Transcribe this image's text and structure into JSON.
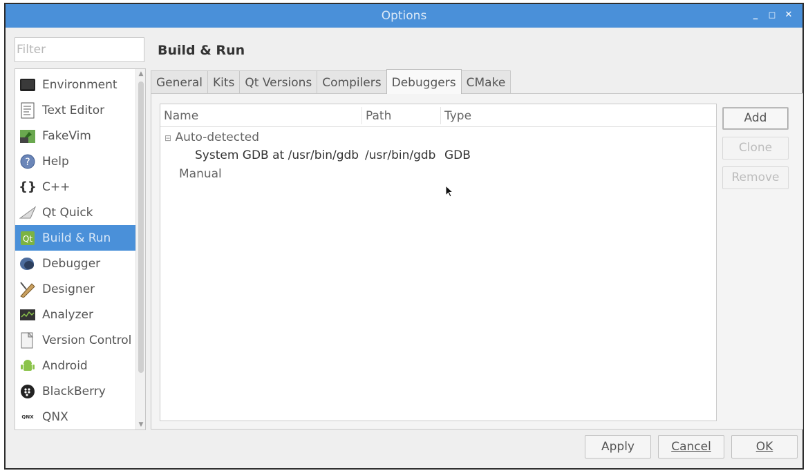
{
  "window": {
    "title": "Options",
    "controls": {
      "minimize": "_",
      "maximize": "□",
      "close": "✕"
    }
  },
  "filter": {
    "placeholder": "Filter",
    "value": ""
  },
  "categories": [
    {
      "label": "Environment",
      "icon": "monitor-icon"
    },
    {
      "label": "Text Editor",
      "icon": "text-document-icon"
    },
    {
      "label": "FakeVim",
      "icon": "fakevim-icon"
    },
    {
      "label": "Help",
      "icon": "help-icon"
    },
    {
      "label": "C++",
      "icon": "braces-icon"
    },
    {
      "label": "Qt Quick",
      "icon": "paper-plane-icon"
    },
    {
      "label": "Build & Run",
      "icon": "build-run-icon",
      "selected": true
    },
    {
      "label": "Debugger",
      "icon": "debugger-icon"
    },
    {
      "label": "Designer",
      "icon": "designer-pen-icon"
    },
    {
      "label": "Analyzer",
      "icon": "analyzer-icon"
    },
    {
      "label": "Version Control",
      "icon": "version-control-icon"
    },
    {
      "label": "Android",
      "icon": "android-icon"
    },
    {
      "label": "BlackBerry",
      "icon": "blackberry-icon"
    },
    {
      "label": "QNX",
      "icon": "qnx-icon"
    }
  ],
  "page": {
    "title": "Build & Run"
  },
  "tabs": [
    {
      "label": "General"
    },
    {
      "label": "Kits"
    },
    {
      "label": "Qt Versions"
    },
    {
      "label": "Compilers"
    },
    {
      "label": "Debuggers",
      "active": true
    },
    {
      "label": "CMake"
    }
  ],
  "tree": {
    "columns": [
      "Name",
      "Path",
      "Type"
    ],
    "groups": [
      {
        "label": "Auto-detected",
        "expander": "⊟",
        "items": [
          {
            "name": "System GDB at /usr/bin/gdb",
            "path": "/usr/bin/gdb",
            "type": "GDB"
          }
        ]
      },
      {
        "label": "Manual",
        "items": []
      }
    ]
  },
  "side_buttons": {
    "add": "Add",
    "clone": "Clone",
    "remove": "Remove"
  },
  "bottom_buttons": {
    "apply": "Apply",
    "cancel": "Cancel",
    "ok": "OK"
  },
  "colors": {
    "titlebar": "#4a90d9",
    "selection": "#4a90d9"
  }
}
